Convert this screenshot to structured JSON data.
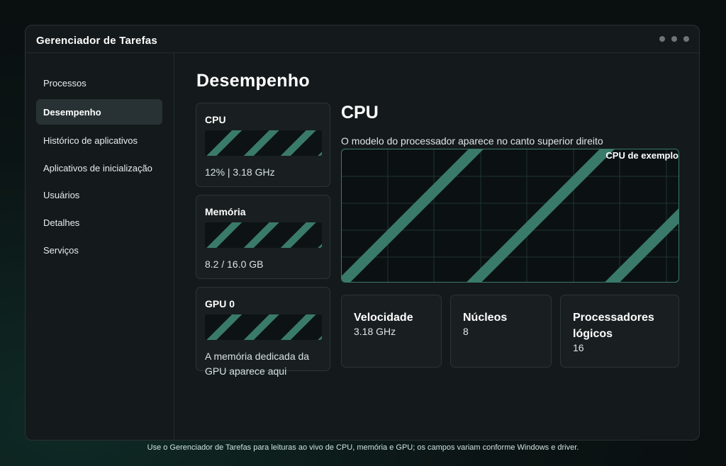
{
  "window": {
    "title": "Gerenciador de Tarefas"
  },
  "sidebar": {
    "items": [
      {
        "label": "Processos"
      },
      {
        "label": "Desempenho",
        "active": true
      },
      {
        "label": "Histórico de aplicativos"
      },
      {
        "label": "Aplicativos de inicialização"
      },
      {
        "label": "Usuários"
      },
      {
        "label": "Detalhes"
      },
      {
        "label": "Serviços"
      }
    ]
  },
  "main": {
    "title": "Desempenho",
    "cards": [
      {
        "title": "CPU",
        "value": "12% | 3.18 GHz"
      },
      {
        "title": "Memória",
        "value": "8.2 / 16.0 GB"
      },
      {
        "title": "GPU 0",
        "value": "A memória dedicada da GPU aparece aqui"
      }
    ],
    "detail": {
      "title": "CPU",
      "description": "O modelo do processador aparece no canto superior direito",
      "graph_label": "CPU de exemplo",
      "stats": [
        {
          "label": "Velocidade",
          "value": "3.18 GHz"
        },
        {
          "label": "Núcleos",
          "value": "8"
        },
        {
          "label": "Processadores lógicos",
          "value": "16"
        }
      ]
    }
  },
  "footer": {
    "text": "Use o Gerenciador de Tarefas para leituras ao vivo de CPU, memória e GPU; os campos variam conforme Windows e driver."
  },
  "colors": {
    "accent": "#3a7a6b",
    "window_bg": "#141a1b",
    "active_nav": "#283234"
  }
}
